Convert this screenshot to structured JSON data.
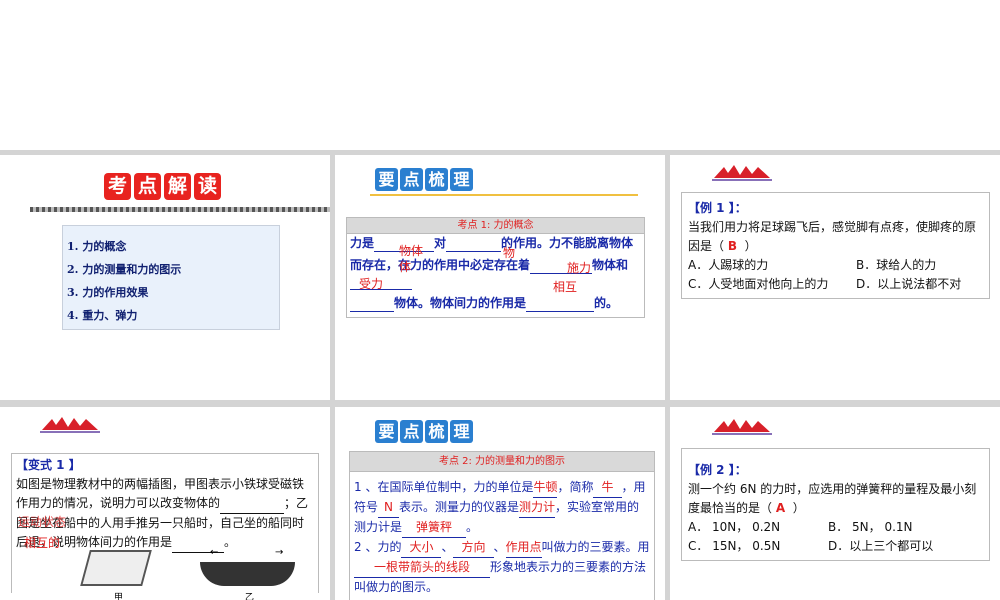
{
  "panel1": {
    "title_chars": [
      "考",
      "点",
      "解",
      "读"
    ],
    "toc": [
      "1. 力的概念",
      "2. 力的测量和力的图示",
      "3. 力的作用效果",
      "4. 重力、弹力"
    ]
  },
  "panel2": {
    "title_chars": [
      "要",
      "点",
      "梳",
      "理"
    ],
    "header": "考点 1: 力的概念",
    "line1a": "力是",
    "line1b": "对",
    "line1c": "的作用。力不能脱离物体",
    "line2a": "而存在，在力的作用中必定存在着",
    "line2b": "物体和",
    "line3": "物体。物体间力的作用是",
    "line3b": "的。",
    "answers": [
      "物体",
      "物",
      "体",
      "施力",
      "受力",
      "相互"
    ]
  },
  "panel3": {
    "label": "【例 1 】：",
    "question": "当我们用力将足球踢飞后，感觉脚有点疼，使脚疼的原因是（",
    "answer": "B",
    "close": "）",
    "options": [
      "A．人踢球的力",
      "B．球给人的力",
      "C．人受地面对他向上的力",
      "D．以上说法都不对"
    ]
  },
  "panel4": {
    "label": "【变式 1 】",
    "text1": "如图是物理教材中的两幅插图，甲图表示小铁球受磁铁作用力的情况，说明力可以改变物体的",
    "text2": "；乙图是坐在船中的人用手推另一只船时，自己坐的船同时后退，说明物体间力的作用是",
    "end": "。",
    "answer1": "运动状态",
    "answer2": "相互的",
    "fig1": "甲",
    "fig2": "乙"
  },
  "panel5": {
    "title_chars": [
      "要",
      "点",
      "梳",
      "理"
    ],
    "header": "考点 2: 力的测量和力的图示",
    "s1": "1 、在国际单位制中，力的单位是",
    "a1": "牛顿",
    "s2": "，简称",
    "a2": "牛",
    "s3": "，用符号",
    "a3": "N",
    "s4": "表示。测量力的仪器是",
    "a4": "测力计",
    "s5": "，实验室常用的测力计是",
    "a5": "弹簧秤",
    "s6": "。",
    "s7": "2 、力的",
    "a6": "大小",
    "a7": "方向",
    "a8": "作用点",
    "s8": "叫做力的三要素。用",
    "a9": "一根带箭头的线段",
    "s9": "形象地表示力的三要素的方法叫做力的图示。"
  },
  "panel6": {
    "label": "【例 2 】：",
    "question": "测一个约 6N 的力时，应选用的弹簧秤的量程及最小刻度最恰当的是（",
    "answer": "A",
    "close": "）",
    "options": [
      "A． 10N， 0.2N",
      "B． 5N， 0.1N",
      "C． 15N， 0.5N",
      "D．以上三个都可以"
    ]
  }
}
